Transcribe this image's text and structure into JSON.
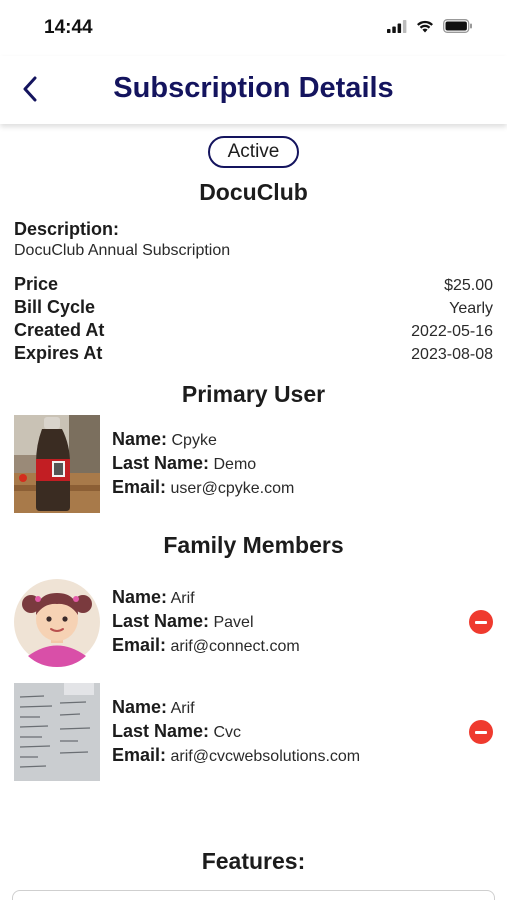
{
  "status_bar": {
    "time": "14:44"
  },
  "nav": {
    "title": "Subscription Details"
  },
  "subscription": {
    "status": "Active",
    "name": "DocuClub",
    "description_label": "Description:",
    "description": "DocuClub Annual Subscription",
    "details": [
      {
        "label": "Price",
        "value": "$25.00"
      },
      {
        "label": "Bill Cycle",
        "value": "Yearly"
      },
      {
        "label": "Created At",
        "value": "2022-05-16"
      },
      {
        "label": "Expires At",
        "value": "2023-08-08"
      }
    ]
  },
  "primary_user": {
    "title": "Primary User",
    "name_label": "Name:",
    "name": "Cpyke",
    "last_name_label": "Last Name:",
    "last_name": "Demo",
    "email_label": "Email:",
    "email": "user@cpyke.com"
  },
  "family": {
    "title": "Family Members",
    "members": [
      {
        "name_label": "Name:",
        "name": "Arif",
        "last_name_label": "Last Name:",
        "last_name": "Pavel",
        "email_label": "Email:",
        "email": "arif@connect.com"
      },
      {
        "name_label": "Name:",
        "name": "Arif",
        "last_name_label": "Last Name:",
        "last_name": "Cvc",
        "email_label": "Email:",
        "email": "arif@cvcwebsolutions.com"
      }
    ]
  },
  "features": {
    "title": "Features:"
  },
  "colors": {
    "accent": "#14145e",
    "remove": "#ef3a2e"
  },
  "icons": {
    "back": "chevron-left-icon",
    "remove": "minus-circle-icon"
  }
}
